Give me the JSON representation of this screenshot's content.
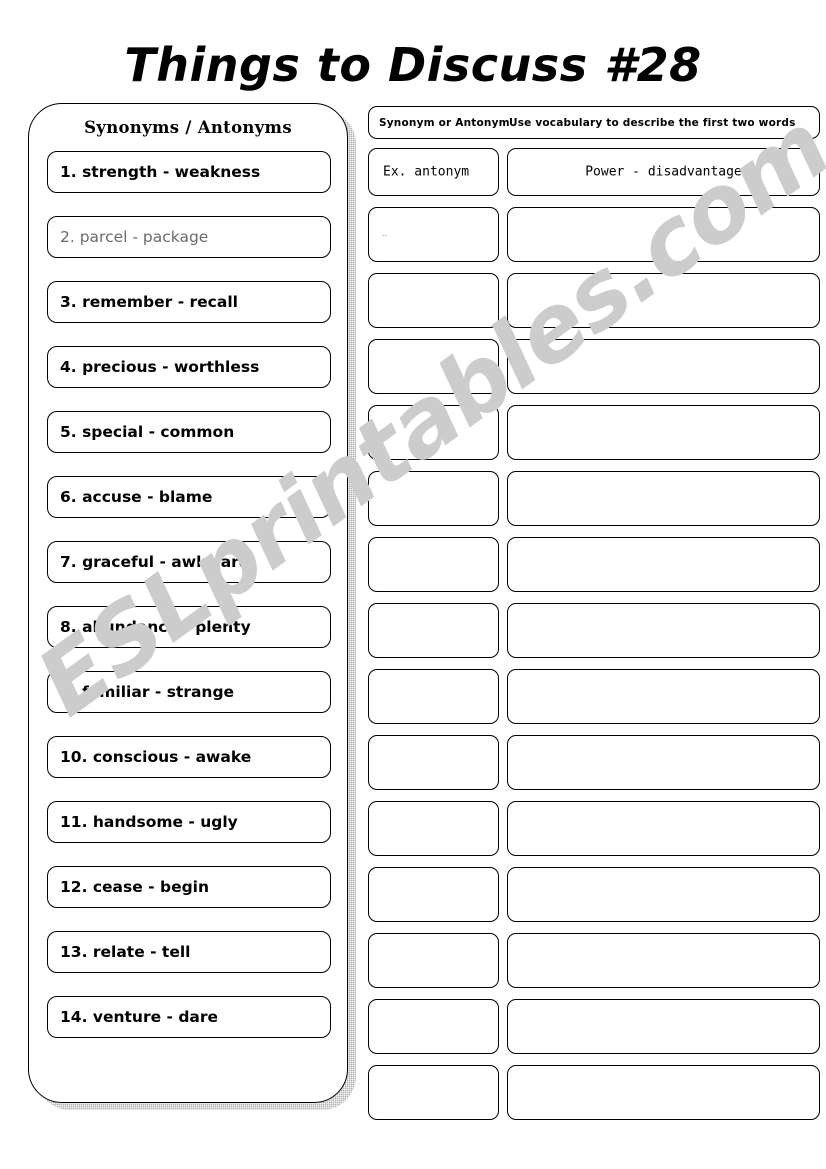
{
  "title": "Things to Discuss #28",
  "watermark": "ESLprintables.com",
  "left_panel": {
    "heading": "Synonyms / Antonyms",
    "items": [
      {
        "text": "1. strength - weakness",
        "faded": false
      },
      {
        "text": "2. parcel - package",
        "faded": true
      },
      {
        "text": "3. remember - recall",
        "faded": false
      },
      {
        "text": "4. precious  -  worthless",
        "faded": false
      },
      {
        "text": "5. special  -  common",
        "faded": false
      },
      {
        "text": "6. accuse  -  blame",
        "faded": false
      },
      {
        "text": "7. graceful  -  awkward",
        "faded": false
      },
      {
        "text": "8. abundance  -  plenty",
        "faded": false
      },
      {
        "text": "9. familiar  -  strange",
        "faded": false
      },
      {
        "text": "10. conscious  -  awake",
        "faded": false
      },
      {
        "text": "11. handsome  -  ugly",
        "faded": false
      },
      {
        "text": "12. cease  -  begin",
        "faded": false
      },
      {
        "text": "13. relate  -  tell",
        "faded": false
      },
      {
        "text": "14. venture  -  dare",
        "faded": false
      }
    ]
  },
  "right_panel": {
    "header": {
      "kind_label": "Synonym or Antonym",
      "description_label": "Use vocabulary to describe the first two words"
    },
    "example": {
      "kind": "Ex.    antonym",
      "description": "Power - disadvantage"
    },
    "blank_rows": [
      {
        "kind": "",
        "description": "",
        "mark": ".."
      },
      {
        "kind": "",
        "description": "",
        "mark": ""
      },
      {
        "kind": "",
        "description": "",
        "mark": ""
      },
      {
        "kind": "",
        "description": "",
        "mark": ""
      },
      {
        "kind": "",
        "description": "",
        "mark": ""
      },
      {
        "kind": "",
        "description": "",
        "mark": ""
      },
      {
        "kind": "",
        "description": "",
        "mark": ""
      },
      {
        "kind": "",
        "description": "",
        "mark": ""
      },
      {
        "kind": "",
        "description": "",
        "mark": ""
      },
      {
        "kind": "",
        "description": "",
        "mark": ""
      },
      {
        "kind": "",
        "description": "",
        "mark": ""
      },
      {
        "kind": "",
        "description": "",
        "mark": ""
      },
      {
        "kind": "",
        "description": "",
        "mark": ""
      },
      {
        "kind": "",
        "description": "",
        "mark": ""
      }
    ]
  },
  "colors": {
    "ink": "#000000",
    "shadow": "#b0b0b0",
    "watermark": "#cccccc",
    "faded_ink": "#6a6a6a"
  }
}
